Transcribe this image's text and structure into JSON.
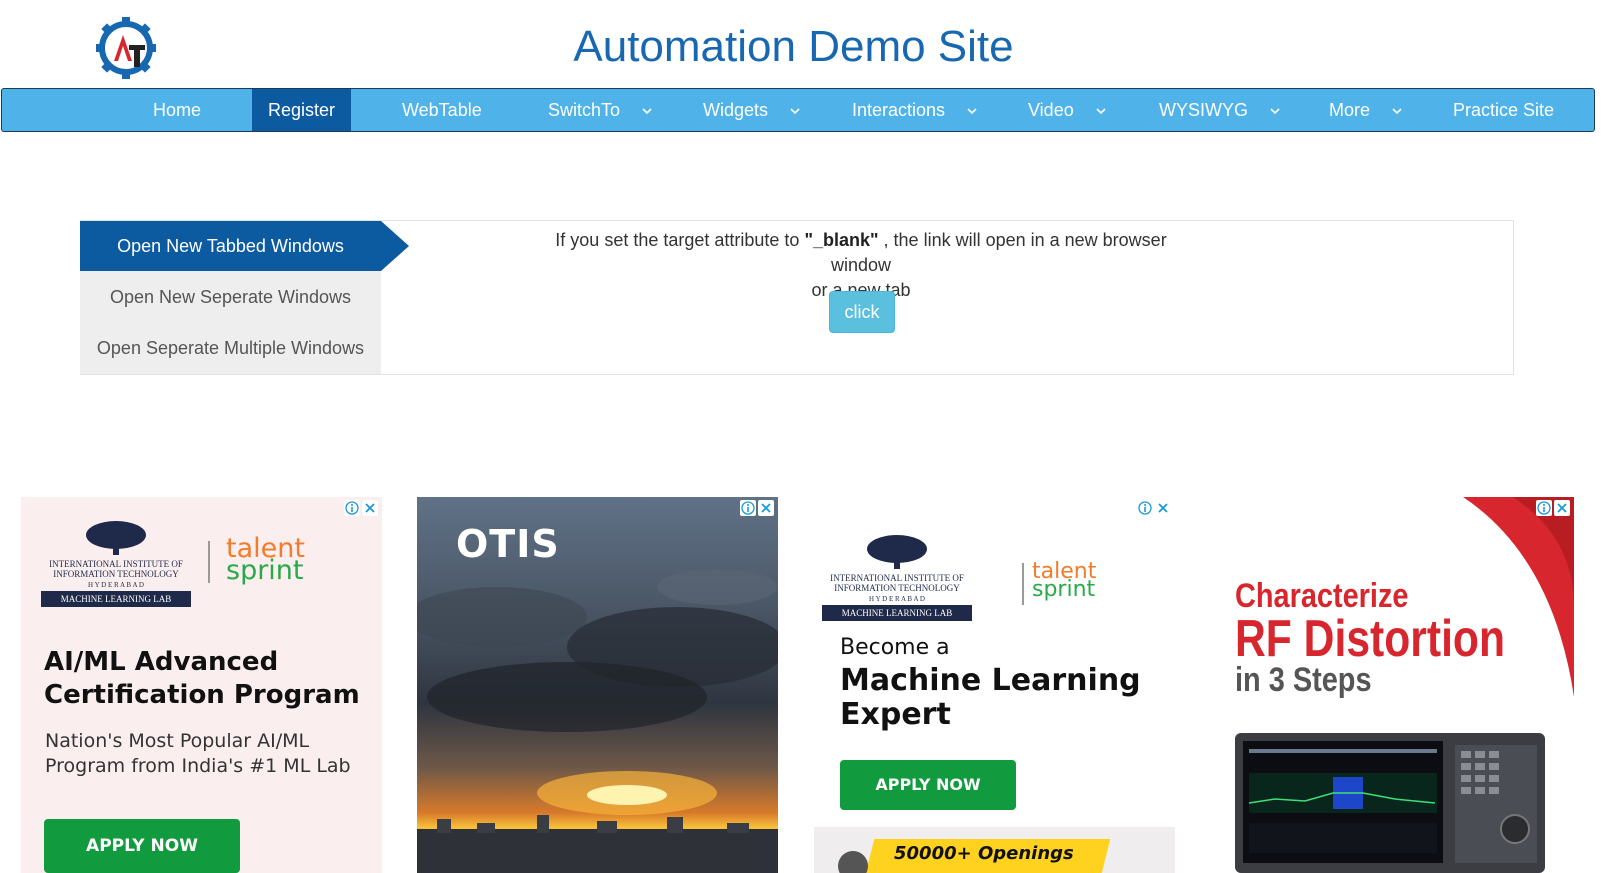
{
  "header": {
    "site_title": "Automation Demo Site",
    "logo_letters": "AT"
  },
  "nav": {
    "items": [
      {
        "label": "Home"
      },
      {
        "label": "Register"
      },
      {
        "label": "WebTable"
      },
      {
        "label": "SwitchTo"
      },
      {
        "label": "Widgets"
      },
      {
        "label": "Interactions"
      },
      {
        "label": "Video"
      },
      {
        "label": "WYSIWYG"
      },
      {
        "label": "More"
      },
      {
        "label": "Practice Site"
      }
    ],
    "active": "Register"
  },
  "tabs": {
    "items": [
      {
        "label": "Open New Tabbed Windows"
      },
      {
        "label": "Open New Seperate Windows"
      },
      {
        "label": "Open Seperate Multiple Windows"
      }
    ],
    "active": "Open New Tabbed Windows"
  },
  "panel": {
    "text_before": "If you set the target attribute to ",
    "text_bold": "\"_blank\"",
    "text_after": " , the link will open in a new browser window",
    "text_line2": "or a new tab",
    "button_label": "click"
  },
  "ads": {
    "ad1": {
      "org_line1": "INTERNATIONAL INSTITUTE OF",
      "org_line2": "INFORMATION TECHNOLOGY",
      "org_line3": "H Y D E R A B A D",
      "lab": "MACHINE LEARNING LAB",
      "talent": "talent",
      "sprint": "sprint",
      "headline1": "AI/ML Advanced",
      "headline2": "Certification Program",
      "sub1": "Nation's Most Popular AI/ML",
      "sub2": "Program from India's #1 ML Lab",
      "button": "APPLY NOW"
    },
    "ad2": {
      "brand": "OTIS"
    },
    "ad3": {
      "org_line1": "INTERNATIONAL INSTITUTE OF",
      "org_line2": "INFORMATION TECHNOLOGY",
      "org_line3": "H Y D E R A B A D",
      "lab": "MACHINE LEARNING LAB",
      "talent": "talent",
      "sprint": "sprint",
      "pre": "Become a",
      "headline1": "Machine Learning",
      "headline2": "Expert",
      "button": "APPLY NOW",
      "banner": "50000+ Openings"
    },
    "ad4": {
      "line1": "Characterize",
      "line2": "RF Distortion",
      "line3": "in 3 Steps"
    }
  },
  "colors": {
    "title_blue": "#1768b0",
    "nav_bg": "#4fb3ea",
    "nav_active": "#0c5aa0",
    "button_info": "#5bc0de",
    "apply_green": "#119a3e",
    "keysight_red": "#d7262e"
  }
}
